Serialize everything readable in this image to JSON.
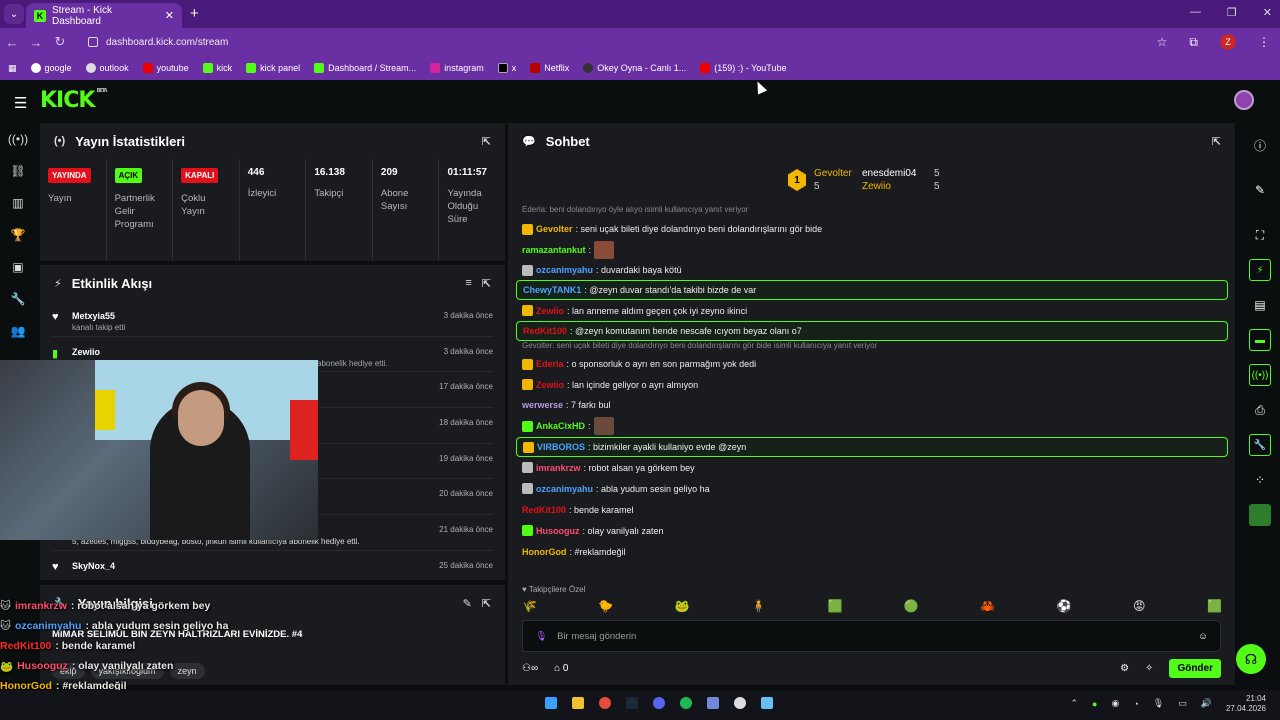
{
  "browser": {
    "tab_title": "Stream - Kick Dashboard",
    "url": "dashboard.kick.com/stream",
    "bookmarks": [
      "google",
      "outlook",
      "youtube",
      "kick",
      "kick panel",
      "Dashboard / Stream...",
      "instagram",
      "x",
      "Netflix",
      "Okey Oyna - Canlı 1...",
      "(159) :) - YouTube"
    ],
    "profile_initial": "Z"
  },
  "kick": {
    "logo": "KICK",
    "logo_sup": "BETA"
  },
  "stats": {
    "title": "Yayın İstatistikleri",
    "items": [
      {
        "badge": "YAYINDA",
        "label": "Yayın"
      },
      {
        "badge": "AÇIK",
        "label": "Partnerlik Gelir Programı"
      },
      {
        "badge": "KAPALI",
        "label": "Çoklu Yayın"
      },
      {
        "value": "446",
        "label": "İzleyici"
      },
      {
        "value": "16.138",
        "label": "Takipçi"
      },
      {
        "value": "209",
        "label": "Abone Sayısı"
      },
      {
        "value": "01:11:57",
        "label": "Yayında Olduğu Süre"
      }
    ]
  },
  "activity": {
    "title": "Etkinlik Akışı",
    "items": [
      {
        "name": "Metxyia55",
        "desc": "kanalı takip etti",
        "time": "3 dakika önce"
      },
      {
        "name": "Zewiio",
        "desc": "abonelik hediye etti.",
        "time": "3 dakika önce"
      },
      {
        "name": "",
        "desc": "",
        "time": "17 dakika önce"
      },
      {
        "name": "",
        "desc": "",
        "time": "18 dakika önce"
      },
      {
        "name": "",
        "desc": "",
        "time": "19 dakika önce"
      },
      {
        "name": "",
        "desc": "",
        "time": "20 dakika önce"
      },
      {
        "name": "",
        "desc": "5, azeties, miggss, biddybeag, bosto, jinkun isimli kullanıcıya abonelik hediye etti.",
        "time": "21 dakika önce"
      },
      {
        "name": "SkyNox_4",
        "desc": "",
        "time": "25 dakika önce"
      }
    ]
  },
  "yayin": {
    "title": "Yayın bilgisi",
    "stream_title": "MİMAR SELİMÜL BİN ZEYN HALTRIZLARI EVİNİZDE. #4",
    "tags": [
      "ekip",
      "yakışıklıoğlum",
      "zeyn"
    ]
  },
  "overlay_chat": [
    {
      "user": "imrankrzw",
      "text": ": robot alsan ya görkem bey",
      "color": "#ff4d6d"
    },
    {
      "user": "ozcanimyahu",
      "text": ": abla yudum sesin geliyo ha",
      "color": "#4da3ff"
    },
    {
      "user": "RedKit100",
      "text": ": bende karamel",
      "color": "#ff2a2a"
    },
    {
      "user": "Husooguz",
      "text": ": olay vanilyalı zaten",
      "color": "#ff4d6d"
    },
    {
      "user": "HonorGod",
      "text": ": #reklamdeğil",
      "color": "#f2b705"
    }
  ],
  "chat": {
    "title": "Sohbet",
    "pinned": [
      {
        "rank": "1",
        "user": "Gevolter",
        "count": "5"
      },
      {
        "user": "enesdemi04",
        "count": "5"
      },
      {
        "user": "Zewiio",
        "count": "5"
      }
    ],
    "messages": [
      {
        "reply": "Ederia: beni dolandırıyo öyle alıyo isimli kullanıcıya yanıt veriyor"
      },
      {
        "user": "Gevolter",
        "color": "#f2b705",
        "text": ": seni uçak bileti diye dolandırıyo beni dolandırışlarını gör bide"
      },
      {
        "user": "ramazantankut",
        "color": "#53fc18",
        "text": ":"
      },
      {
        "user": "ozcanimyahu",
        "color": "#4da3ff",
        "text": ": duvardaki baya kötü"
      },
      {
        "user": "ChewyTANK1",
        "color": "#4da3ff",
        "text": ": @zeyn duvar standı'da takibi bizde de var",
        "hl": true
      },
      {
        "user": "Zewiio",
        "color": "#e0111b",
        "text": ": lan anneme aldım geçen çok iyi zeyno ikinci"
      },
      {
        "user": "RedKit100",
        "color": "#e0111b",
        "text": ": @zeyn komutanım bende nescafe ıcıyom beyaz olanı o7",
        "hl": true
      },
      {
        "reply": "Gevolter: seni uçak bileti diye dolandırıyo beni dolandırışlarını gör bide isimli kullanıcıya yanıt veriyor"
      },
      {
        "user": "Ederia",
        "color": "#e0111b",
        "text": ": o sponsorluk o ayrı en son parmağım yok dedi"
      },
      {
        "user": "Zewiio",
        "color": "#e0111b",
        "text": ": lan içinde geliyor o ayrı almıyon"
      },
      {
        "user": "werwerse",
        "color": "#b39ddb",
        "text": ": 7 farkı bul"
      },
      {
        "user": "AnkaCixHD",
        "color": "#53fc18",
        "text": ":"
      },
      {
        "user": "VIRBOROS",
        "color": "#4da3ff",
        "text": ": bizimkiler ayakli kullaniyo evde @zeyn",
        "hl": true
      },
      {
        "user": "imrankrzw",
        "color": "#ff4d6d",
        "text": ": robot alsan ya görkem bey"
      },
      {
        "user": "ozcanimyahu",
        "color": "#4da3ff",
        "text": ": abla yudum sesin geliyo ha"
      },
      {
        "user": "RedKit100",
        "color": "#e0111b",
        "text": ": bende karamel"
      },
      {
        "user": "Husooguz",
        "color": "#ff4d6d",
        "text": ": olay vanilyalı zaten"
      },
      {
        "user": "HonorGod",
        "color": "#f2b705",
        "text": ": #reklamdeğil"
      }
    ],
    "follow_only": "Takipçilere Özel",
    "placeholder": "Bir mesaj gönderin",
    "footer_count": "0",
    "send_label": "Gönder"
  },
  "taskbar": {
    "time": "21:04",
    "date": "27.04.2026"
  }
}
